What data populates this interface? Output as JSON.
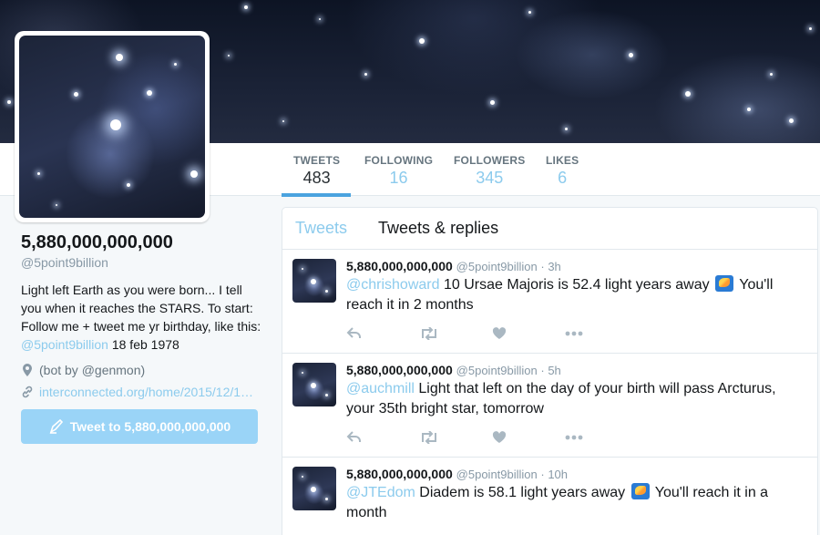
{
  "stats": [
    {
      "label": "TWEETS",
      "value": "483"
    },
    {
      "label": "FOLLOWING",
      "value": "16"
    },
    {
      "label": "FOLLOWERS",
      "value": "345"
    },
    {
      "label": "LIKES",
      "value": "6"
    }
  ],
  "profile": {
    "name": "5,880,000,000,000",
    "handle": "@5point9billion",
    "bio_1": "Light left Earth as you were born... I tell you when it reaches the STARS. To start: Follow me + tweet me yr birthday, like this: ",
    "bio_mention": "@5point9billion",
    "bio_2": " 18 feb 1978",
    "location": "(bot by @genmon)",
    "url": "interconnected.org/home/2015/12/1…",
    "tweet_button": "Tweet to 5,880,000,000,000"
  },
  "timeline": {
    "tabs": [
      {
        "label": "Tweets"
      },
      {
        "label": "Tweets & replies"
      }
    ],
    "tweets": [
      {
        "name": "5,880,000,000,000",
        "meta": "@5point9billion · 3h",
        "mention": "@chrishoward",
        "text_1": " 10 Ursae Majoris is 52.4 light years away ",
        "text_2": " You'll reach it in 2 months"
      },
      {
        "name": "5,880,000,000,000",
        "meta": "@5point9billion · 5h",
        "mention": "@auchmill",
        "text_1": " Light that left on the day of your birth will pass Arcturus, your 35th bright star, tomorrow",
        "text_2": ""
      },
      {
        "name": "5,880,000,000,000",
        "meta": "@5point9billion · 10h",
        "mention": "@JTEdom",
        "text_1": " Diadem is 58.1 light years away ",
        "text_2": " You'll reach it in a month"
      }
    ]
  },
  "colors": {
    "accent": "#8ccbed",
    "button": "#9ad4f7",
    "underline": "#4aa3df"
  }
}
